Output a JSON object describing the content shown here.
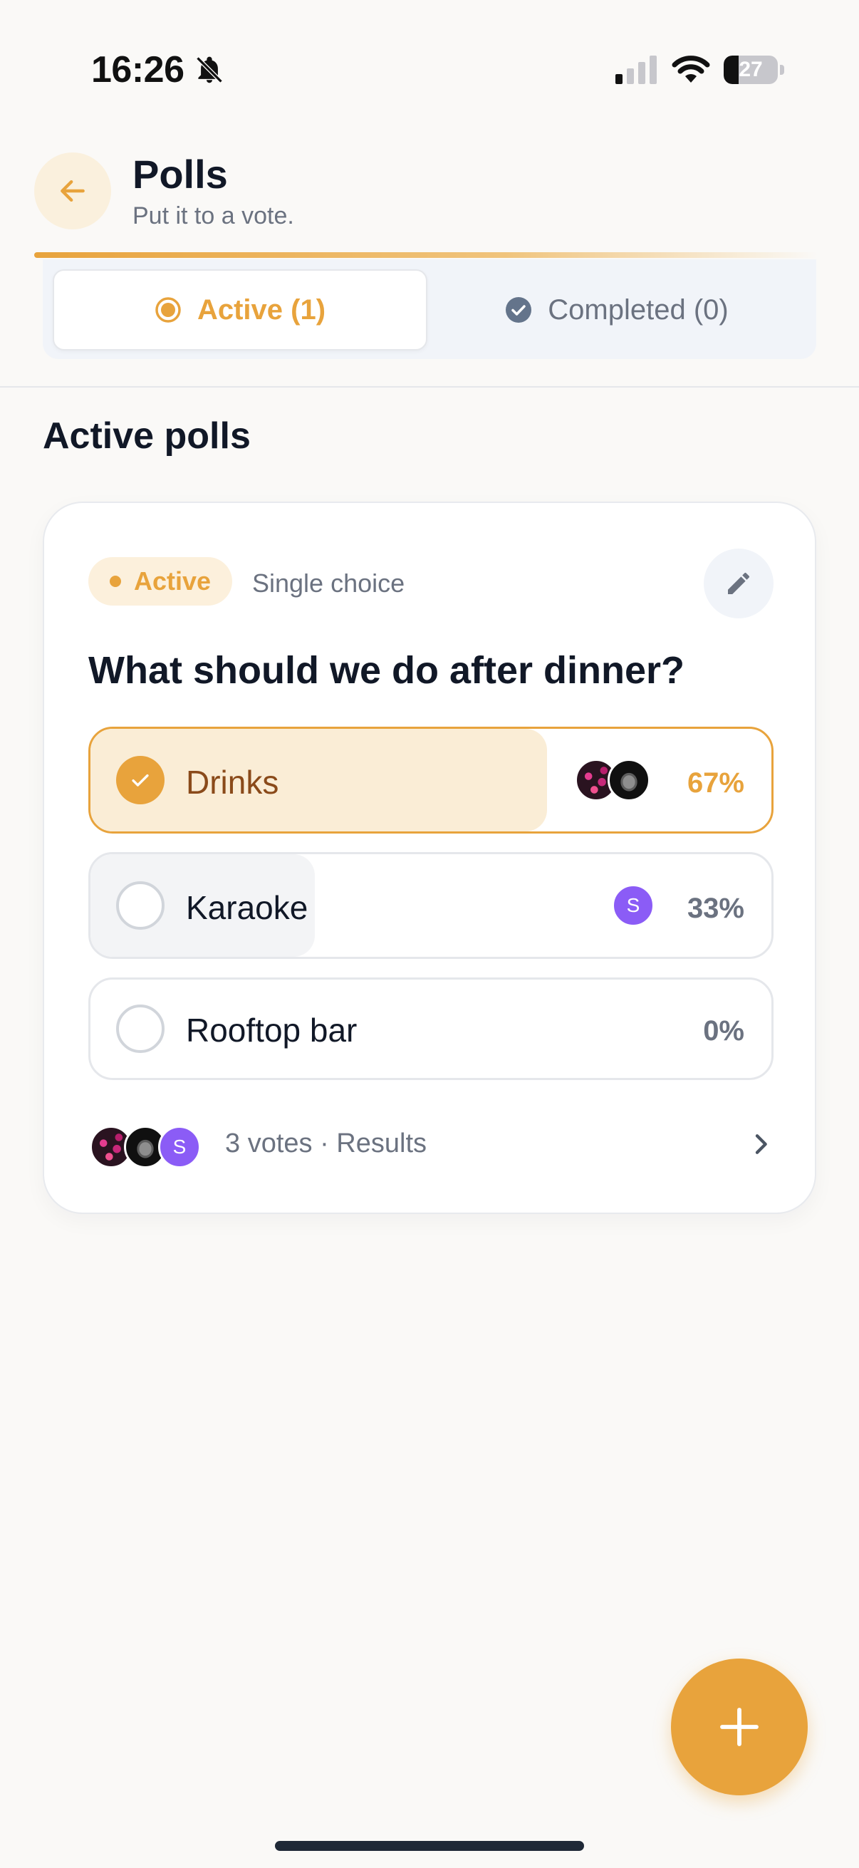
{
  "status_bar": {
    "time": "16:26",
    "battery_percent": "27",
    "battery_level": 0.27
  },
  "header": {
    "title": "Polls",
    "subtitle": "Put it to a vote."
  },
  "tabs": [
    {
      "label": "Active (1)",
      "active": true
    },
    {
      "label": "Completed (0)",
      "active": false
    }
  ],
  "section_title": "Active polls",
  "poll": {
    "status_badge": "Active",
    "choice_type": "Single choice",
    "question": "What should we do after dinner?",
    "options": [
      {
        "label": "Drinks",
        "percent": "67%",
        "fraction": 0.67,
        "selected": true,
        "voters": [
          "flowers",
          "dog"
        ]
      },
      {
        "label": "Karaoke",
        "percent": "33%",
        "fraction": 0.33,
        "selected": false,
        "voters": [
          "S"
        ]
      },
      {
        "label": "Rooftop bar",
        "percent": "0%",
        "fraction": 0.0,
        "selected": false,
        "voters": []
      }
    ],
    "summary": "3 votes · Results",
    "summary_voters": [
      "flowers",
      "dog",
      "S"
    ]
  },
  "colors": {
    "accent": "#e8a33c",
    "purple_avatar": "#8b5cf6",
    "text_dark": "#111827",
    "text_muted": "#6b7280"
  }
}
